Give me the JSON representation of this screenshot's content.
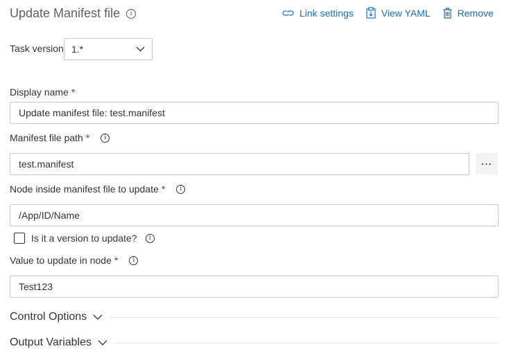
{
  "header": {
    "title": "Update Manifest file",
    "actions": {
      "link_settings": "Link settings",
      "view_yaml": "View YAML",
      "remove": "Remove"
    }
  },
  "task_version": {
    "label": "Task version",
    "value": "1.*"
  },
  "fields": {
    "display_name": {
      "label": "Display name",
      "required": "*",
      "value": "Update manifest file: test.manifest"
    },
    "manifest_path": {
      "label": "Manifest file path",
      "required": "*",
      "value": "test.manifest",
      "browse": "⋯"
    },
    "node": {
      "label": "Node inside manifest file to update",
      "required": "*",
      "value": "/App/ID/Name"
    },
    "is_version": {
      "label": "Is it a version to update?",
      "checked": false
    },
    "value": {
      "label": "Value to update in node",
      "required": "*",
      "value": "Test123"
    }
  },
  "sections": {
    "control_options": "Control Options",
    "output_variables": "Output Variables"
  },
  "colors": {
    "accent": "#106ebe",
    "required": "#a4262c",
    "border": "#c8c8c8"
  }
}
